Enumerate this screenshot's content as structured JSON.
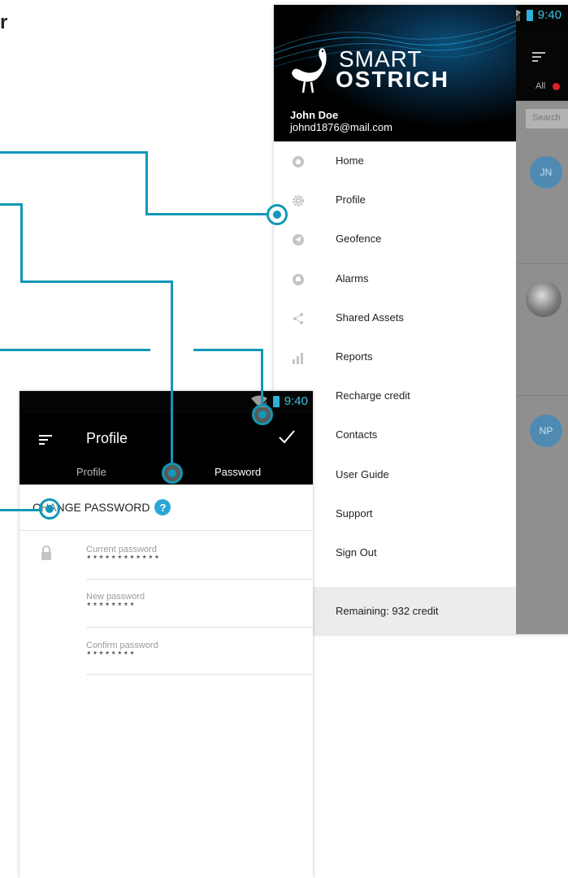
{
  "partial_title": "r",
  "status_bar": {
    "time": "9:40"
  },
  "drawer": {
    "logo": {
      "line1": "SMART",
      "line2": "OSTRICH"
    },
    "user": {
      "name": "John Doe",
      "email": "johnd1876@mail.com"
    },
    "menu": [
      {
        "label": "Home",
        "icon": "home-icon"
      },
      {
        "label": "Profile",
        "icon": "gear-icon"
      },
      {
        "label": "Geofence",
        "icon": "navigation-arrow-icon"
      },
      {
        "label": "Alarms",
        "icon": "alarm-icon"
      },
      {
        "label": "Shared Assets",
        "icon": "share-icon"
      },
      {
        "label": "Reports",
        "icon": "bar-chart-icon"
      },
      {
        "label": "Recharge credit",
        "icon": "credit-icon"
      },
      {
        "label": "Contacts",
        "icon": "contacts-icon"
      },
      {
        "label": "User Guide",
        "icon": "guide-icon"
      },
      {
        "label": "Support",
        "icon": "support-icon"
      },
      {
        "label": "Sign Out",
        "icon": "sign-out-icon"
      }
    ],
    "remaining": "Remaining:  932 credit"
  },
  "behind": {
    "tab_all": "All",
    "search_placeholder": "Search",
    "avatars": [
      "JN",
      "NP"
    ]
  },
  "profile_screen": {
    "title": "Profile",
    "tabs": [
      {
        "label": "Profile",
        "active": false
      },
      {
        "label": "Password",
        "active": true
      }
    ],
    "section_title": "CHANGE PASSWORD",
    "fields": [
      {
        "label": "Current password",
        "value": "************"
      },
      {
        "label": "New password",
        "value": "********"
      },
      {
        "label": "Confirm password",
        "value": "********"
      }
    ]
  },
  "colors": {
    "accent": "#1297b7",
    "help": "#2aa7d8",
    "status_icons": "#3ec4e6",
    "app_bar": "#000000"
  }
}
